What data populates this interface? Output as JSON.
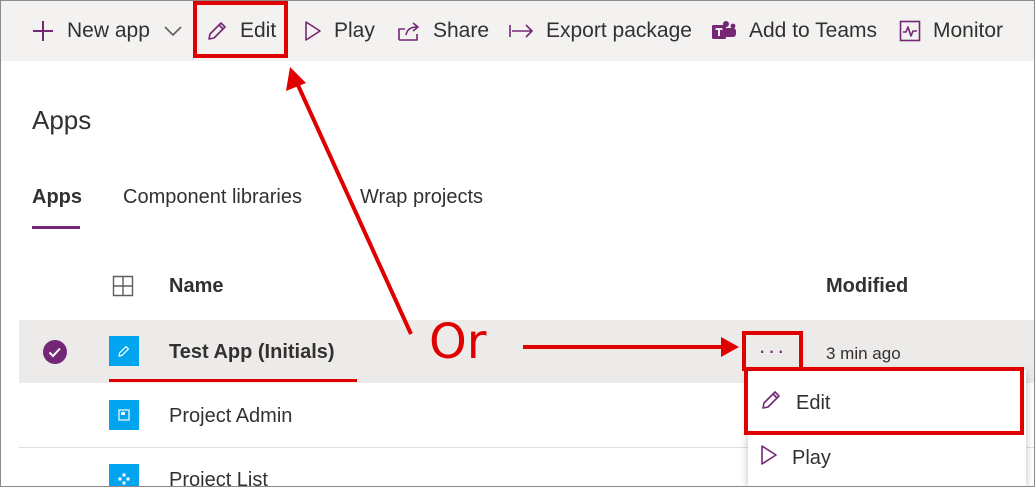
{
  "toolbar": {
    "new_app_label": "New app",
    "edit_label": "Edit",
    "play_label": "Play",
    "share_label": "Share",
    "export_label": "Export package",
    "teams_label": "Add to Teams",
    "monitor_label": "Monitor"
  },
  "page": {
    "title": "Apps"
  },
  "tabs": [
    {
      "label": "Apps",
      "active": true
    },
    {
      "label": "Component libraries",
      "active": false
    },
    {
      "label": "Wrap projects",
      "active": false
    }
  ],
  "table": {
    "headers": {
      "name": "Name",
      "modified": "Modified"
    },
    "rows": [
      {
        "name": "Test App (Initials)",
        "modified": "3 min ago",
        "selected": true
      },
      {
        "name": "Project Admin",
        "modified": ""
      },
      {
        "name": "Project List",
        "modified": ""
      }
    ],
    "more_label": "···"
  },
  "context_menu": {
    "items": [
      {
        "label": "Edit"
      },
      {
        "label": "Play"
      }
    ]
  },
  "annotation": {
    "or_text": "Or"
  },
  "colors": {
    "accent": "#742774",
    "annotation_red": "#e00000",
    "app_icon_blue": "#00a4ef",
    "toolbar_bg": "#f3f2f1"
  }
}
